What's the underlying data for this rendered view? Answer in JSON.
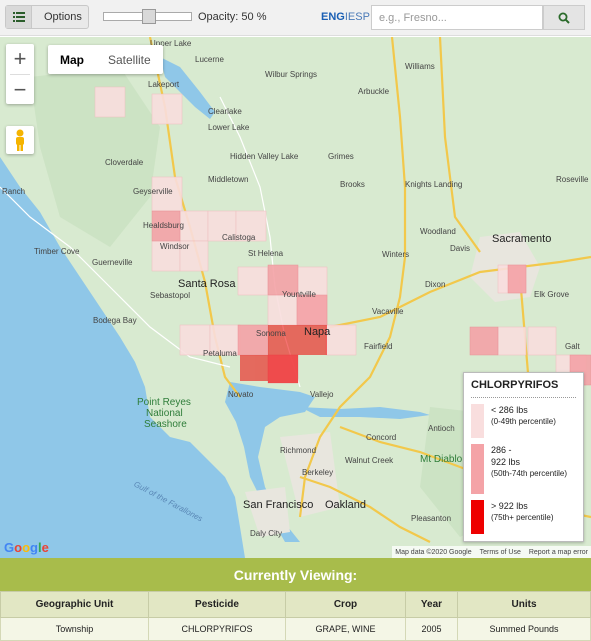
{
  "toolbar": {
    "options_label": "Options",
    "opacity_label": "Opacity: 50 %",
    "opacity_value": 50,
    "lang_en": "ENG",
    "lang_separator": "I",
    "lang_es": "ESP",
    "search_placeholder": "e.g., Fresno..."
  },
  "map": {
    "map_button": "Map",
    "satellite_button": "Satellite",
    "active_maptype": "Map",
    "zoom_in": "+",
    "zoom_out": "−",
    "google_logo": "Google",
    "attribution": {
      "map_data": "Map data ©2020 Google",
      "terms": "Terms of Use",
      "report": "Report a map error"
    },
    "labels": {
      "upper_lake": "Upper Lake",
      "lucerne": "Lucerne",
      "lakeport": "Lakeport",
      "wilbur_springs": "Wilbur Springs",
      "arbuckle": "Arbuckle",
      "williams": "Williams",
      "clearlake": "Clearlake",
      "lower_lake": "Lower Lake",
      "cloverdale": "Cloverdale",
      "hidden_valley_lake": "Hidden Valley Lake",
      "middletown": "Middletown",
      "grimes": "Grimes",
      "brooks": "Brooks",
      "knights_landing": "Knights Landing",
      "roseville": "Roseville",
      "geyserville": "Geyserville",
      "healdsburg": "Healdsburg",
      "calistoga": "Calistoga",
      "woodland": "Woodland",
      "windsor": "Windsor",
      "timber_cove": "Timber Cove",
      "guerneville": "Guerneville",
      "davis": "Davis",
      "sacramento": "Sacramento",
      "st_helena": "St Helena",
      "winters": "Winters",
      "santa_rosa": "Santa Rosa",
      "sebastopol": "Sebastopol",
      "yountville": "Yountville",
      "dixon": "Dixon",
      "elk_grove": "Elk Grove",
      "bodega_bay": "Bodega Bay",
      "vacaville": "Vacaville",
      "sonoma": "Sonoma",
      "napa": "Napa",
      "petaluma": "Petaluma",
      "fairfield": "Fairfield",
      "novato": "Novato",
      "vallejo": "Vallejo",
      "point_reyes_1": "Point Reyes",
      "point_reyes_2": "National",
      "point_reyes_3": "Seashore",
      "concord": "Concord",
      "antioch": "Antioch",
      "richmond": "Richmond",
      "walnut_creek": "Walnut Creek",
      "mt_diablo": "Mt Diablo",
      "berkeley": "Berkeley",
      "san_francisco": "San Francisco",
      "oakland": "Oakland",
      "pleasanton": "Pleasanton",
      "daly_city": "Daly City",
      "gulf_farallones": "Gulf of the Farallones",
      "ranch": "Ranch",
      "galt": "Galt"
    }
  },
  "legend": {
    "title": "CHLORPYRIFOS",
    "items": [
      {
        "line1": "< 286  lbs",
        "line2": "(0-49th percentile)",
        "color": "#f9dede"
      },
      {
        "line1": "286   -",
        "line1b": "922  lbs",
        "line2": "(50th-74th percentile)",
        "color": "#f4a3a7"
      },
      {
        "line1": "> 922 lbs",
        "line2": "(75th+ percentile)",
        "color": "#ee0000"
      }
    ]
  },
  "currently_viewing": {
    "title": "Currently Viewing:",
    "columns": [
      "Geographic Unit",
      "Pesticide",
      "Crop",
      "Year",
      "Units"
    ],
    "row": [
      "Township",
      "CHLORPYRIFOS",
      "GRAPE, WINE",
      "2005",
      "Summed Pounds"
    ]
  },
  "colors": {
    "header_green": "#a8bc4b",
    "low": "#f9dede",
    "mid": "#f4a3a7",
    "high": "#ee0000"
  }
}
